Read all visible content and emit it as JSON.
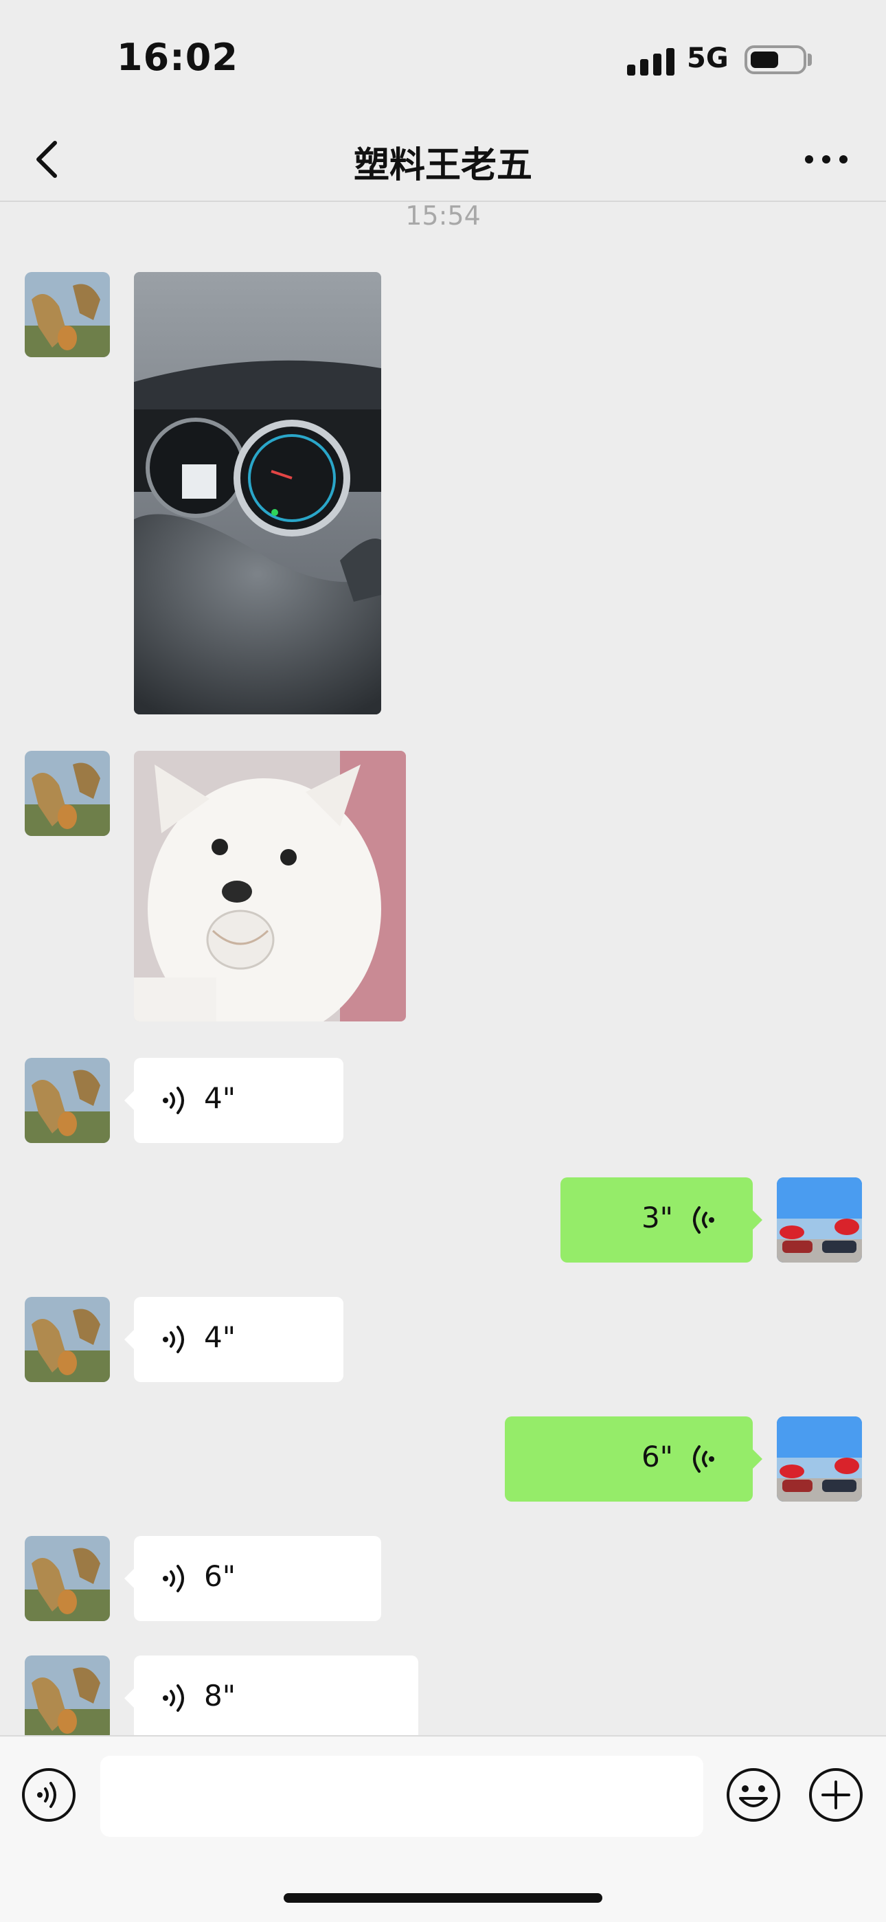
{
  "status_bar": {
    "time": "16:02",
    "network": "5G",
    "battery_level": 0.55
  },
  "nav": {
    "title": "塑料王老五",
    "back_icon": "chevron-left-icon",
    "more_icon": "more-dots-icon"
  },
  "chat": {
    "timestamp": "15:54",
    "messages": [
      {
        "type": "image",
        "direction": "incoming",
        "description": "car dashboard photo"
      },
      {
        "type": "image",
        "direction": "incoming",
        "description": "white dog sticker"
      },
      {
        "type": "voice",
        "direction": "incoming",
        "duration": "4\""
      },
      {
        "type": "voice",
        "direction": "outgoing",
        "duration": "3\""
      },
      {
        "type": "voice",
        "direction": "incoming",
        "duration": "4\""
      },
      {
        "type": "voice",
        "direction": "outgoing",
        "duration": "6\""
      },
      {
        "type": "voice",
        "direction": "incoming",
        "duration": "6\""
      },
      {
        "type": "voice",
        "direction": "incoming",
        "duration": "8\""
      }
    ]
  },
  "input_bar": {
    "text_value": "",
    "voice_icon": "voice-toggle-icon",
    "emoji_icon": "emoji-icon",
    "plus_icon": "plus-icon"
  },
  "colors": {
    "background": "#EDEDED",
    "outgoing_bubble": "#95EC69",
    "incoming_bubble": "#FFFFFF"
  }
}
